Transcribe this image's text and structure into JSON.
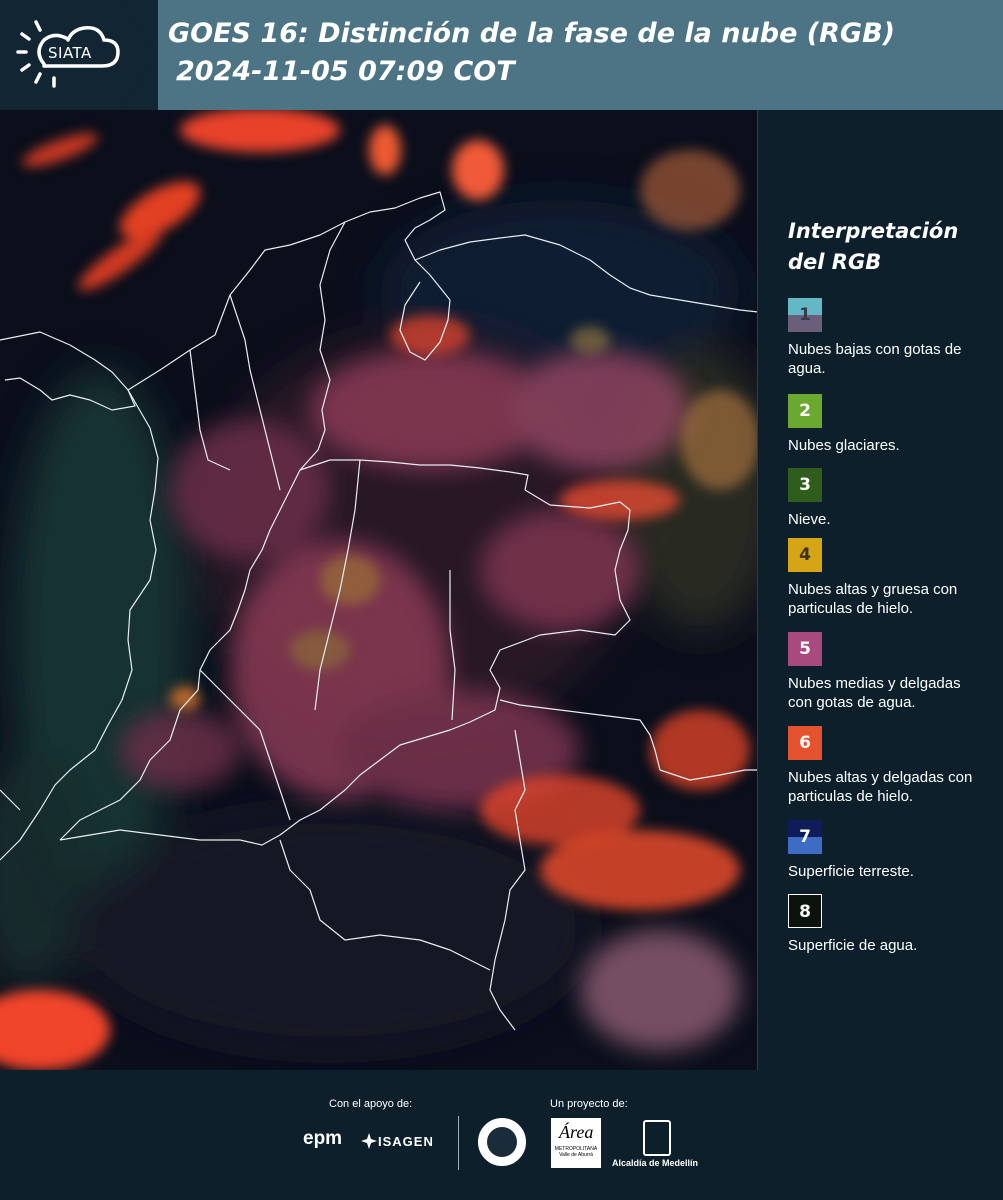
{
  "header": {
    "logo": "SIATA",
    "title": "GOES 16: Distinción de la fase de la nube (RGB)",
    "subtitle": "2024-11-05 07:09 COT"
  },
  "legend": {
    "title_line1": "Interpretación",
    "title_line2": "del RGB",
    "items": [
      {
        "number": "1",
        "label": "Nubes bajas con gotas de agua.",
        "color_top": "#63b8c6",
        "color_bottom": "#6b5e7a",
        "text_color": "#3a3a4a"
      },
      {
        "number": "2",
        "label": "Nubes glaciares.",
        "color_top": "#6aa830",
        "color_bottom": "#6aa830",
        "text_color": "#ffffff"
      },
      {
        "number": "3",
        "label": "Nieve.",
        "color_top": "#2f5e1c",
        "color_bottom": "#2f5e1c",
        "text_color": "#ffffff"
      },
      {
        "number": "4",
        "label": "Nubes altas y gruesa con particulas de hielo.",
        "color_top": "#d6a516",
        "color_bottom": "#d6a516",
        "text_color": "#3a3320"
      },
      {
        "number": "5",
        "label": "Nubes medias y delgadas con gotas de agua.",
        "color_top": "#a84a7e",
        "color_bottom": "#a84a7e",
        "text_color": "#ffffff"
      },
      {
        "number": "6",
        "label": "Nubes altas y delgadas con particulas de hielo.",
        "color_top": "#e4532e",
        "color_bottom": "#e4532e",
        "text_color": "#ffffff"
      },
      {
        "number": "7",
        "label": "Superficie terreste.",
        "color_top": "#0f1c5c",
        "color_bottom": "#3e6bc4",
        "text_color": "#ffffff"
      },
      {
        "number": "8",
        "label": "Superficie de agua.",
        "color_top": "#0a140c",
        "color_bottom": "#0a140c",
        "text_color": "#ffffff"
      }
    ]
  },
  "footer": {
    "support_label": "Con el apoyo de:",
    "project_label": "Un proyecto de:",
    "sponsor1": "epm",
    "sponsor2": "ISAGEN",
    "partner_area": "Área",
    "partner_area_sub": "METROPOLITANA Valle de Aburrá",
    "partner_alcaldia": "Alcaldía de Medellín"
  }
}
